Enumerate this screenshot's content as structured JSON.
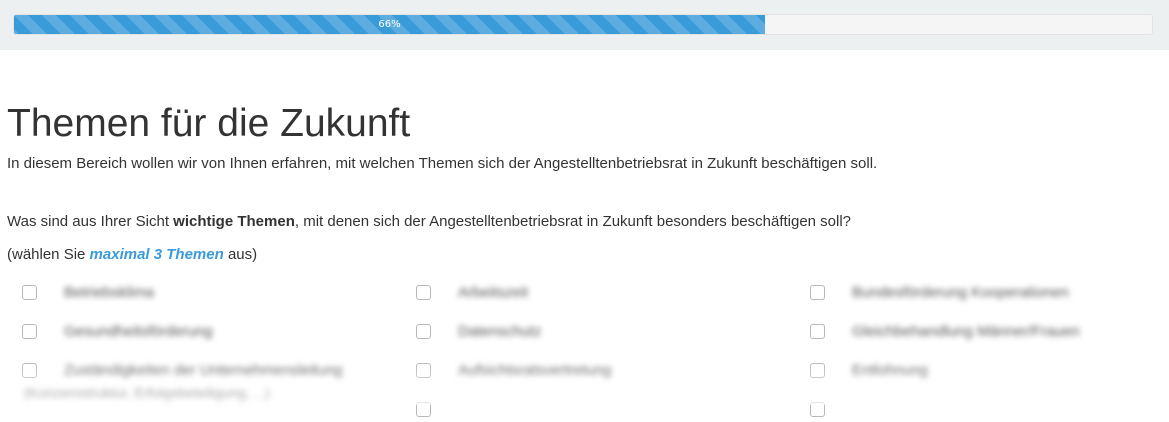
{
  "progress": {
    "label": "66%",
    "value": 0.66,
    "color": "#3a9bd9"
  },
  "section": {
    "title": "Themen für die Zukunft",
    "intro": "In diesem Bereich wollen wir von Ihnen erfahren, mit welchen Themen sich der Angestelltenbetriebsrat in Zukunft beschäftigen soll."
  },
  "question": {
    "text_before": "Was sind aus Ihrer Sicht ",
    "text_bold": "wichtige Themen",
    "text_after": ", mit denen sich der Angestelltenbetriebsrat in Zukunft besonders beschäftigen soll?",
    "hint_before": "(wählen Sie ",
    "hint_accent": "maximal 3 Themen",
    "hint_after": " aus)",
    "accent_color": "#3a9bd9"
  },
  "options": [
    {
      "label": "Betriebsklima",
      "checked": false
    },
    {
      "label": "Arbeitszeit",
      "checked": false
    },
    {
      "label": "Bundesförderung Kooperationen",
      "checked": false
    },
    {
      "label": "Gesundheitsförderung",
      "checked": false
    },
    {
      "label": "Datenschutz",
      "checked": false
    },
    {
      "label": "Gleichbehandlung Männer/Frauen",
      "checked": false
    },
    {
      "label": "Zuständigkeiten der Unternehmensleitung",
      "label_line2": "(Konzernstruktur, Erfolgsbeteiligung, ...)",
      "checked": false
    },
    {
      "label": "Aufsichtsratsvertretung",
      "checked": false
    },
    {
      "label": "Entlohnung",
      "checked": false
    }
  ]
}
